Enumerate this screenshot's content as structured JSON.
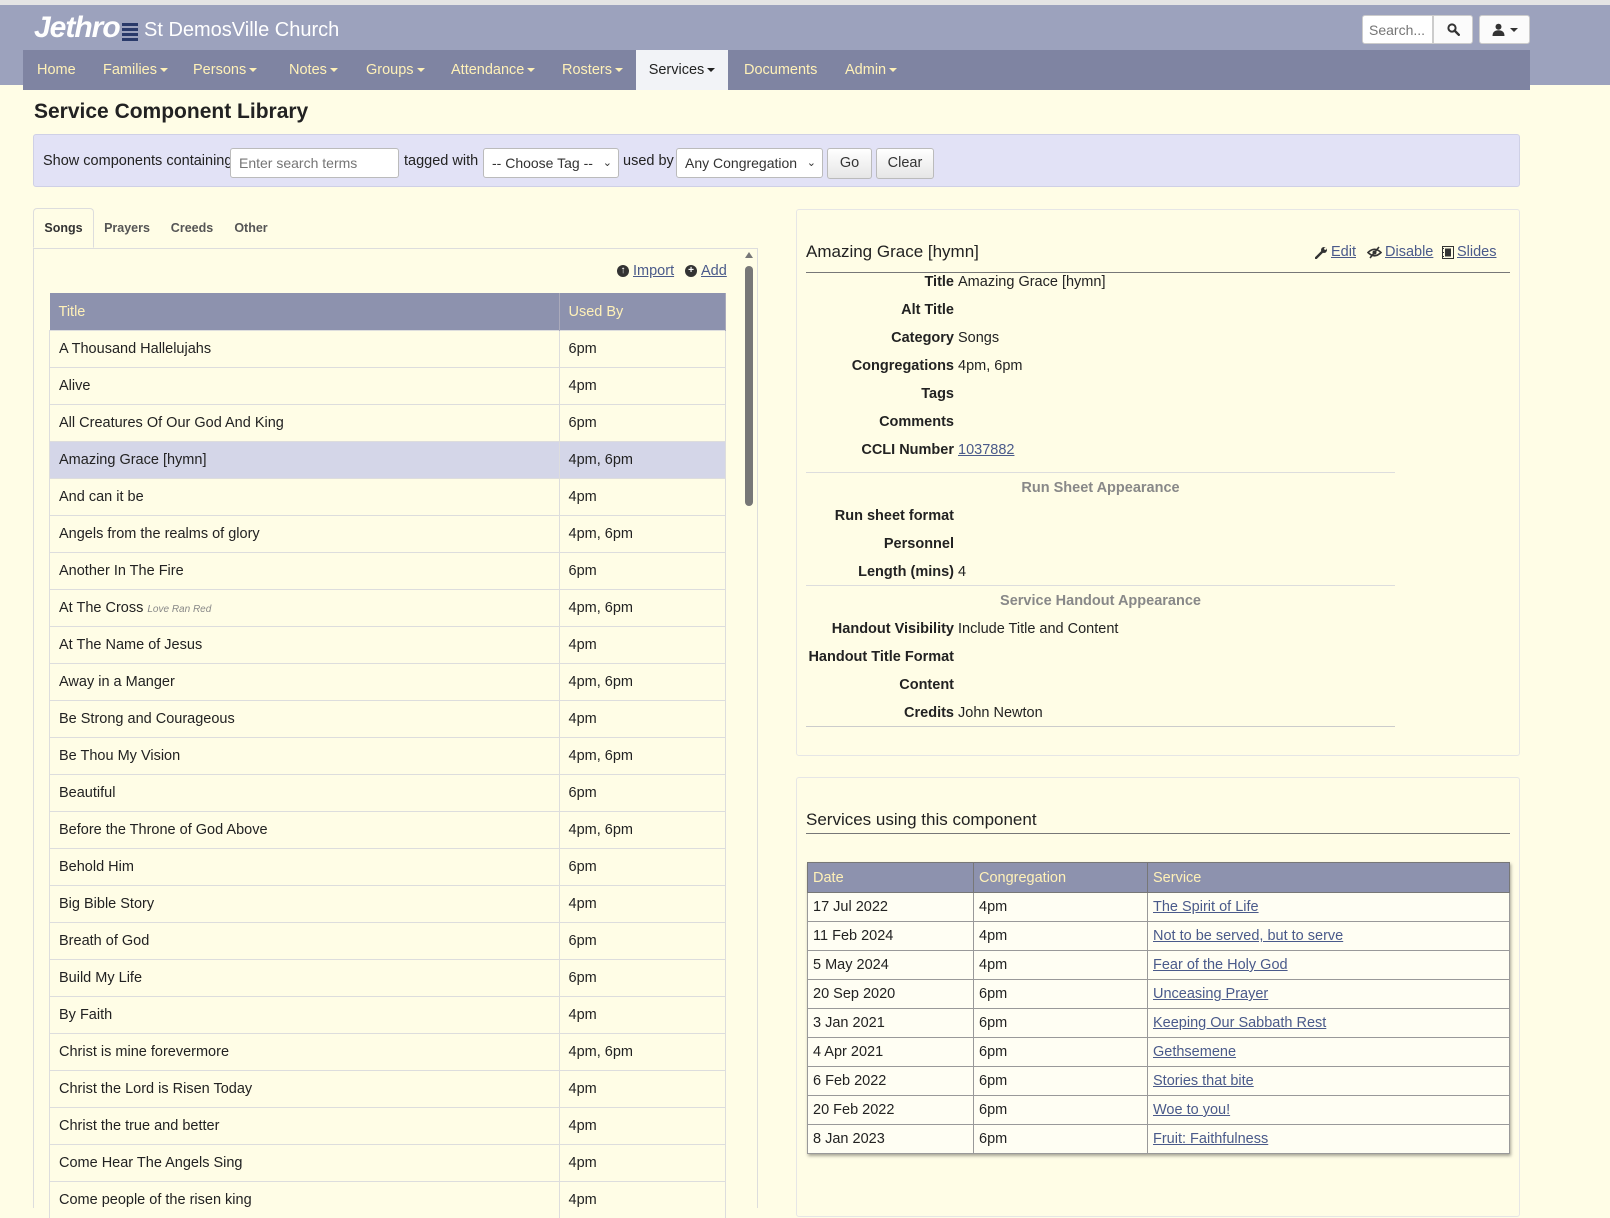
{
  "header": {
    "brand": "Jethro",
    "church_name": "St DemosVille Church",
    "search_placeholder": "Search...",
    "nav": [
      {
        "label": "Home",
        "dropdown": false
      },
      {
        "label": "Families",
        "dropdown": true
      },
      {
        "label": "Persons",
        "dropdown": true
      },
      {
        "label": "Notes",
        "dropdown": true
      },
      {
        "label": "Groups",
        "dropdown": true
      },
      {
        "label": "Attendance",
        "dropdown": true
      },
      {
        "label": "Rosters",
        "dropdown": true
      },
      {
        "label": "Services",
        "dropdown": true,
        "active": true
      },
      {
        "label": "Documents",
        "dropdown": false
      },
      {
        "label": "Admin",
        "dropdown": true
      }
    ]
  },
  "page": {
    "title": "Service Component Library"
  },
  "filter": {
    "label_containing": "Show components containing",
    "search_placeholder": "Enter search terms",
    "label_tagged": "tagged with",
    "tag_selected": "-- Choose Tag --",
    "label_used_by": "used by",
    "congregation_selected": "Any Congregation",
    "go_label": "Go",
    "clear_label": "Clear"
  },
  "tabs": [
    "Songs",
    "Prayers",
    "Creeds",
    "Other"
  ],
  "list": {
    "import_label": "Import",
    "add_label": "Add",
    "columns": [
      "Title",
      "Used By"
    ],
    "rows": [
      {
        "title": "A Thousand Hallelujahs",
        "alt": "",
        "used_by": "6pm"
      },
      {
        "title": "Alive",
        "alt": "",
        "used_by": "4pm"
      },
      {
        "title": "All Creatures Of Our God And King",
        "alt": "",
        "used_by": "6pm"
      },
      {
        "title": "Amazing Grace [hymn]",
        "alt": "",
        "used_by": "4pm, 6pm",
        "selected": true
      },
      {
        "title": "And can it be",
        "alt": "",
        "used_by": "4pm"
      },
      {
        "title": "Angels from the realms of glory",
        "alt": "",
        "used_by": "4pm, 6pm"
      },
      {
        "title": "Another In The Fire",
        "alt": "",
        "used_by": "6pm"
      },
      {
        "title": "At The Cross",
        "alt": "Love Ran Red",
        "used_by": "4pm, 6pm"
      },
      {
        "title": "At The Name of Jesus",
        "alt": "",
        "used_by": "4pm"
      },
      {
        "title": "Away in a Manger",
        "alt": "",
        "used_by": "4pm, 6pm"
      },
      {
        "title": "Be Strong and Courageous",
        "alt": "",
        "used_by": "4pm"
      },
      {
        "title": "Be Thou My Vision",
        "alt": "",
        "used_by": "4pm, 6pm"
      },
      {
        "title": "Beautiful",
        "alt": "",
        "used_by": "6pm"
      },
      {
        "title": "Before the Throne of God Above",
        "alt": "",
        "used_by": "4pm, 6pm"
      },
      {
        "title": "Behold Him",
        "alt": "",
        "used_by": "6pm"
      },
      {
        "title": "Big Bible Story",
        "alt": "",
        "used_by": "4pm"
      },
      {
        "title": "Breath of God",
        "alt": "",
        "used_by": "6pm"
      },
      {
        "title": "Build My Life",
        "alt": "",
        "used_by": "6pm"
      },
      {
        "title": "By Faith",
        "alt": "",
        "used_by": "4pm"
      },
      {
        "title": "Christ is mine forevermore",
        "alt": "",
        "used_by": "4pm, 6pm"
      },
      {
        "title": "Christ the Lord is Risen Today",
        "alt": "",
        "used_by": "4pm"
      },
      {
        "title": "Christ the true and better",
        "alt": "",
        "used_by": "4pm"
      },
      {
        "title": "Come Hear The Angels Sing",
        "alt": "",
        "used_by": "4pm"
      },
      {
        "title": "Come people of the risen king",
        "alt": "",
        "used_by": "4pm"
      }
    ]
  },
  "detail": {
    "heading": "Amazing Grace [hymn]",
    "actions": {
      "edit": "Edit",
      "disable": "Disable",
      "slides": "Slides"
    },
    "fields": [
      {
        "label": "Title",
        "value": "Amazing Grace [hymn]"
      },
      {
        "label": "Alt Title",
        "value": ""
      },
      {
        "label": "Category",
        "value": "Songs"
      },
      {
        "label": "Congregations",
        "value": "4pm, 6pm"
      },
      {
        "label": "Tags",
        "value": ""
      },
      {
        "label": "Comments",
        "value": ""
      },
      {
        "label": "CCLI Number",
        "value": "1037882",
        "link": true
      }
    ],
    "run_sheet_title": "Run Sheet Appearance",
    "run_sheet_fields": [
      {
        "label": "Run sheet format",
        "value": ""
      },
      {
        "label": "Personnel",
        "value": ""
      },
      {
        "label": "Length (mins)",
        "value": "4"
      }
    ],
    "handout_title": "Service Handout Appearance",
    "handout_fields": [
      {
        "label": "Handout Visibility",
        "value": "Include Title and Content"
      },
      {
        "label": "Handout Title Format",
        "value": ""
      },
      {
        "label": "Content",
        "value": ""
      },
      {
        "label": "Credits",
        "value": "John Newton"
      }
    ]
  },
  "services": {
    "heading": "Services using this component",
    "columns": [
      "Date",
      "Congregation",
      "Service"
    ],
    "rows": [
      {
        "date": "17 Jul 2022",
        "congregation": "4pm",
        "service": "The Spirit of Life"
      },
      {
        "date": "11 Feb 2024",
        "congregation": "4pm",
        "service": "Not to be served, but to serve"
      },
      {
        "date": "5 May 2024",
        "congregation": "4pm",
        "service": "Fear of the Holy God"
      },
      {
        "date": "20 Sep 2020",
        "congregation": "6pm",
        "service": "Unceasing Prayer"
      },
      {
        "date": "3 Jan 2021",
        "congregation": "6pm",
        "service": "Keeping Our Sabbath Rest"
      },
      {
        "date": "4 Apr 2021",
        "congregation": "6pm",
        "service": "Gethsemene"
      },
      {
        "date": "6 Feb 2022",
        "congregation": "6pm",
        "service": "Stories that bite"
      },
      {
        "date": "20 Feb 2022",
        "congregation": "6pm",
        "service": "Woe to you!"
      },
      {
        "date": "8 Jan 2023",
        "congregation": "6pm",
        "service": "Fruit: Faithfulness"
      }
    ]
  },
  "colors": {
    "page_bg": "#fffde6",
    "header_bg": "#9ca2bd",
    "nav_bg": "#7f84a2",
    "nav_text": "#fff1b8",
    "table_header_bg": "#8d92ae",
    "filter_bg": "#e2e2f6",
    "selected_row_bg": "#d4d6e8",
    "link": "#4a5a8a"
  }
}
